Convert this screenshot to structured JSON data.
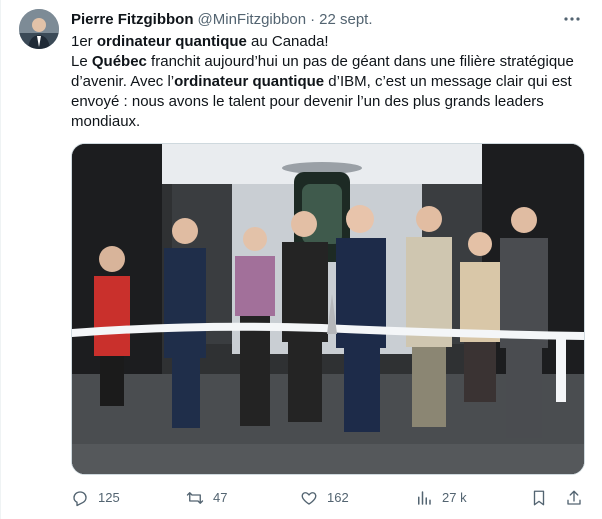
{
  "tweet": {
    "author_name": "Pierre Fitzgibbon",
    "handle": "@MinFitzgibbon",
    "separator": "·",
    "date": "22 sept.",
    "text": {
      "line1_a": "1er ",
      "line1_bold": "ordinateur quantique",
      "line1_b": " au Canada!",
      "p2_a": "Le ",
      "p2_bold1": "Québec",
      "p2_b": " franchit aujourd’hui un pas de géant dans une filière stratégique d’avenir. Avec l’",
      "p2_bold2": "ordinateur quantique",
      "p2_c": " d’IBM, c’est un message clair qui est envoyé : nous avons le talent pour devenir l’un des plus grands leaders mondiaux."
    },
    "stats": {
      "replies": "125",
      "retweets": "47",
      "likes": "162",
      "views": "27 k"
    }
  },
  "icons": {
    "more": "more-icon",
    "reply": "reply-icon",
    "retweet": "retweet-icon",
    "like": "heart-icon",
    "views": "views-icon",
    "bookmark": "bookmark-icon",
    "share": "share-icon"
  },
  "colors": {
    "text": "#0f1419",
    "secondary": "#536471",
    "border": "#cfd9de"
  }
}
